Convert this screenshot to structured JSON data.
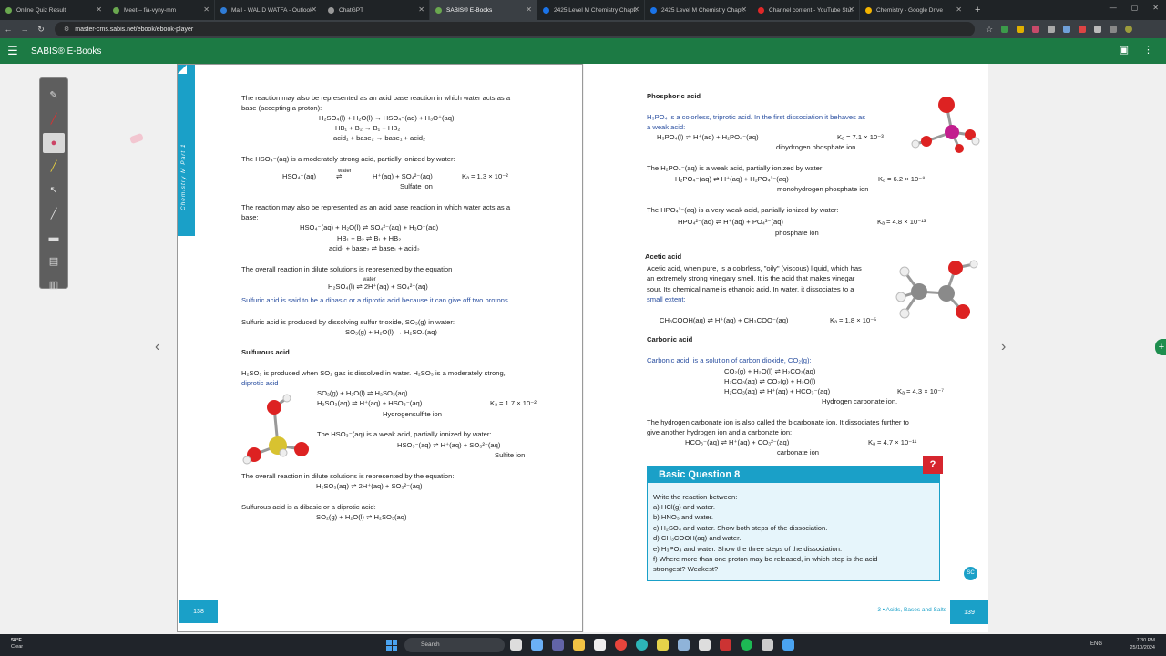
{
  "browser": {
    "tabs": [
      {
        "label": "Online Quiz Result",
        "color": "#4caf50"
      },
      {
        "label": "Meet – fia-vyny-mm",
        "color": "#00a86b"
      },
      {
        "label": "Mail - WALID WATFA - Outlook",
        "color": "#2f7cd6"
      },
      {
        "label": "ChatGPT",
        "color": "#999999"
      },
      {
        "label": "SABIS® E-Books",
        "color": "#1c7a44"
      },
      {
        "label": "2425 Level M Chemistry Chapt.",
        "color": "#1a73e8"
      },
      {
        "label": "2425 Level M Chemistry Chapt.",
        "color": "#1a73e8"
      },
      {
        "label": "Channel content - YouTube Stu.",
        "color": "#e02828"
      },
      {
        "label": "Chemistry - Google Drive",
        "color": "#f4b400"
      }
    ],
    "new_tab": "+",
    "url": "master-cms.sabis.net/ebook/ebook-player"
  },
  "app": {
    "title": "SABIS® E-Books"
  },
  "left_page": {
    "spine_text": "Chemistry M Part 1",
    "page_number": "138",
    "lines": {
      "p1": "The reaction may also be represented as an acid base reaction in which water acts as a",
      "p1b": "base (accepting a proton):",
      "e1": "H₂SO₄(l) + H₂O(l) → HSO₄⁻(aq) + H₃O⁺(aq)",
      "e2": "HB₁ + B₂ → B₁ + HB₂",
      "e3": "acid₁ + base₂ → base₁ + acid₂",
      "p2": "The HSO₄⁻(aq) is a moderately strong acid, partially ionized by water:",
      "e4": "HSO₄⁻(aq)",
      "e4w": "water",
      "e4b": "H⁺(aq) + SO₄²⁻(aq)",
      "e4k": "Kₐ = 1.3 × 10⁻²",
      "e4n": "Sulfate ion",
      "p3": "The reaction may also be represented as an acid base reaction in which water acts as a",
      "p3b": "base:",
      "e5": "HSO₄⁻(aq) + H₂O(l) ⇌ SO₄²⁻(aq) + H₃O⁺(aq)",
      "e6": "HB₁ + B₂ ⇌ B₁ + HB₂",
      "e7": "acid₁ + base₂ ⇌ base₁ + acid₂",
      "p4": "The overall reaction in dilute solutions is represented by the equation",
      "e8": "H₂SO₄(l) ⇌ 2H⁺(aq) + SO₄²⁻(aq)",
      "e8w": "water",
      "p5": "Sulfuric acid is said to be a dibasic or a diprotic acid because it can give off two protons.",
      "p6": "Sulfuric acid is produced by dissolving sulfur trioxide, SO₃(g) in water:",
      "e9": "SO₃(g) + H₂O(l) → H₂SO₄(aq)",
      "h1": "Sulfurous acid",
      "p7": "H₂SO₃ is produced when SO₂ gas is dissolved in water. H₂SO₃ is a moderately strong,",
      "p7b": "diprotic acid",
      "e10": "SO₂(g) + H₂O(l) ⇌ H₂SO₃(aq)",
      "e11": "H₂SO₃(aq) ⇌ H⁺(aq) + HSO₃⁻(aq)",
      "e11k": "Kₐ = 1.7 × 10⁻²",
      "e11n": "Hydrogensulfite ion",
      "p8": "The HSO₃⁻(aq) is a weak acid, partially ionized by water:",
      "e12": "HSO₃⁻(aq) ⇌ H⁺(aq) + SO₃²⁻(aq)",
      "e12n": "Sulfite ion",
      "p9": "The overall reaction in dilute solutions is represented by the equation:",
      "e13": "H₂SO₃(aq) ⇌ 2H⁺(aq) + SO₃²⁻(aq)",
      "p10": "Sulfurous acid is a dibasic or a diprotic acid:",
      "e14": "SO₂(g) + H₂O(l) ⇌ H₂SO₃(aq)"
    }
  },
  "right_page": {
    "page_number": "139",
    "chapter_footer": "3 • Acids, Bases and Salts",
    "lines": {
      "h1": "Phosphoric acid",
      "p1": "H₃PO₄ is a colorless, triprotic acid. In the first dissociation it behaves as",
      "p1b": "a weak acid:",
      "e1": "H₃PO₄(l) ⇌ H⁺(aq) + H₂PO₄⁻(aq)",
      "e1k": "Kₐ = 7.1 × 10⁻³",
      "e1n": "dihydrogen phosphate ion",
      "p2": "The H₂PO₄⁻(aq) is a weak acid, partially ionized by water:",
      "e2": "H₂PO₄⁻(aq) ⇌ H⁺(aq) + H₂PO₄²⁻(aq)",
      "e2k": "Kₐ = 6.2 × 10⁻⁸",
      "e2n": "monohydrogen phosphate ion",
      "p3": "The HPO₄²⁻(aq) is a very weak acid, partially ionized by water:",
      "e3": "HPO₄²⁻(aq) ⇌ H⁺(aq) + PO₄³⁻(aq)",
      "e3k": "Kₐ = 4.8 × 10⁻¹³",
      "e3n": "phosphate ion",
      "h2": "Acetic acid",
      "p4": "Acetic acid, when pure, is a colorless, \"oily\" (viscous) liquid, which has",
      "p4b": "an extremely strong vinegary smell. It is the acid that makes vinegar",
      "p4c": "sour. Its chemical name is ethanoic acid. In water, it dissociates to a",
      "p4d": "small extent:",
      "e4": "CH₃COOH(aq) ⇌ H⁺(aq) + CH₃COO⁻(aq)",
      "e4k": "Kₐ = 1.8 × 10⁻⁵",
      "h3": "Carbonic acid",
      "p5": "Carbonic acid, is a solution of carbon dioxide, CO₂(g):",
      "e5": "CO₂(g) + H₂O(l) ⇌ H₂CO₃(aq)",
      "e6": "H₂CO₃(aq) ⇌ CO₂(g) + H₂O(l)",
      "e7": "H₂CO₃(aq) ⇌ H⁺(aq) + HCO₃⁻(aq)",
      "e7k": "Kₐ = 4.3 × 10⁻⁷",
      "e7n": "Hydrogen carbonate ion.",
      "p6": "The hydrogen carbonate ion is also called the bicarbonate ion. It dissociates further to",
      "p6b": "give another hydrogen ion and a carbonate ion:",
      "e8": "HCO₃⁻(aq) ⇌ H⁺(aq) + CO₃²⁻(aq)",
      "e8k": "Kₐ = 4.7 × 10⁻¹¹",
      "e8n": "carbonate ion"
    },
    "basic_question": {
      "title": "Basic Question 8",
      "badge": "?",
      "lines": [
        "Write the reaction between:",
        "a) HCl(g) and water.",
        "b) HNO₃ and water.",
        "c) H₂SO₄ and water. Show both steps of the dissociation.",
        "d) CH₃COOH(aq) and water.",
        "e) H₃PO₄ and water. Show the three steps of the dissociation.",
        "f) Where more than one proton may be released, in which step is the acid",
        "   strongest? Weakest?"
      ]
    },
    "logo": "SC"
  },
  "taskbar": {
    "weather_temp": "58°F",
    "weather_desc": "Clear",
    "search": "Search",
    "lang": "ENG",
    "time": "7:30 PM",
    "date": "25/10/2024"
  }
}
